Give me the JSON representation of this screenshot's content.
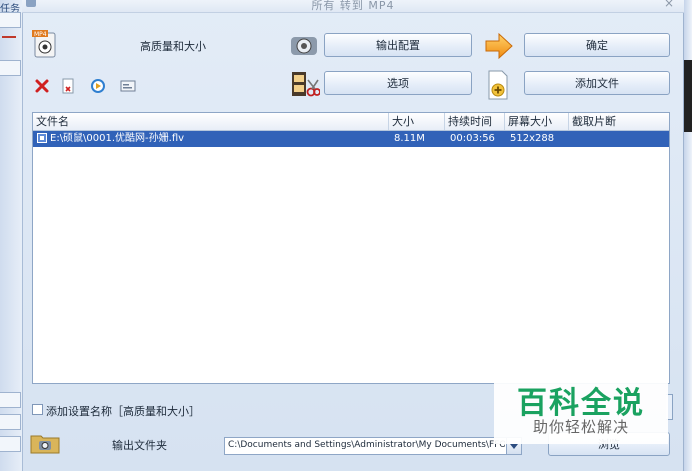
{
  "window": {
    "title": "所有 转到 MP4",
    "close_glyph": "×"
  },
  "toolbar": {
    "profile_label": "高质量和大小",
    "output_config": "输出配置",
    "ok": "确定",
    "options": "选项",
    "add_file": "添加文件",
    "profile_icon_text": "MP4"
  },
  "table": {
    "columns": [
      "文件名",
      "大小",
      "持续时间",
      "屏幕大小",
      "截取片断"
    ],
    "rows": [
      {
        "name": "E:\\硕鼠\\0001.优酷网-孙姗.flv",
        "size": "8.11M",
        "duration": "00:03:56",
        "screen": "512x288",
        "clip": ""
      }
    ]
  },
  "bottom": {
    "add_setting_name": "添加设置名称［高质量和大小］",
    "output_folder": "输出文件夹",
    "output_path": "C:\\Documents and Settings\\Administrator\\My Documents\\FFO",
    "browse": "浏览"
  },
  "watermark": {
    "big": "百科全说",
    "small": "助你轻松解决"
  },
  "left_app": {
    "text": "任务"
  }
}
